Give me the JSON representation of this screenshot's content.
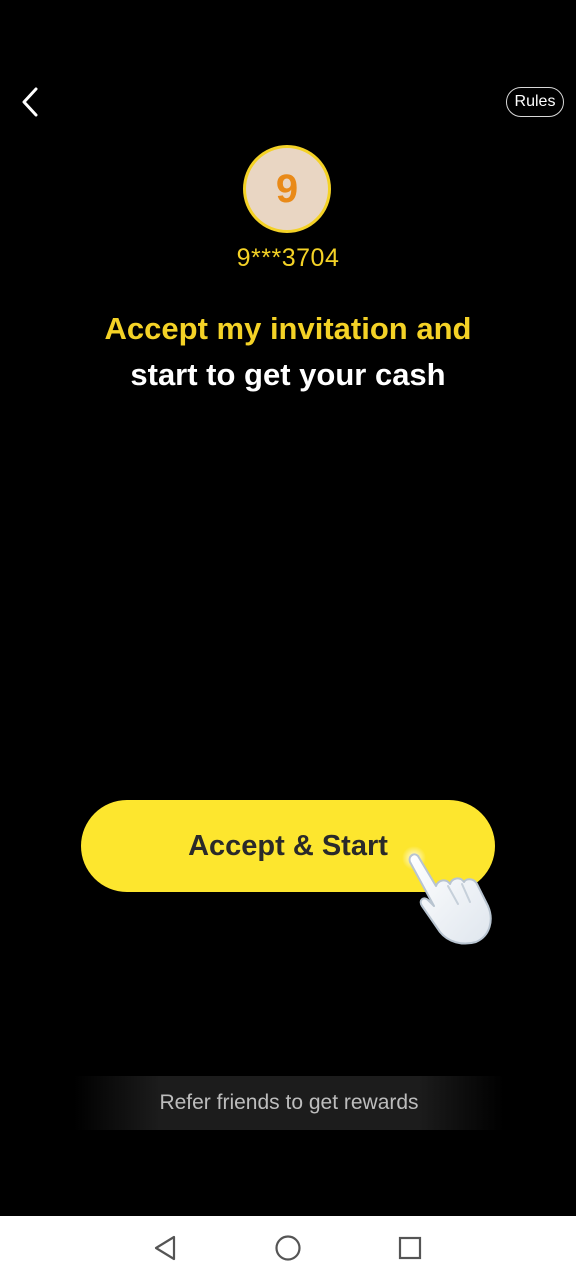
{
  "header": {
    "back_icon": "chevron-left-icon",
    "rules_label": "Rules"
  },
  "inviter": {
    "avatar_letter": "9",
    "masked_id": "9***3704"
  },
  "headline": {
    "line1": "Accept my invitation and",
    "line2": "start to get your cash"
  },
  "cta": {
    "label": "Accept & Start",
    "hand_icon": "pointing-hand-icon"
  },
  "footer": {
    "refer_text": "Refer friends to get rewards"
  },
  "system_nav": {
    "back_icon": "triangle-back-icon",
    "home_icon": "circle-home-icon",
    "recents_icon": "square-recents-icon"
  },
  "colors": {
    "background": "#000000",
    "accent_yellow": "#f4d226",
    "button_yellow": "#fde62e",
    "avatar_bg": "#e9d6c3",
    "avatar_letter": "#e98a18"
  }
}
